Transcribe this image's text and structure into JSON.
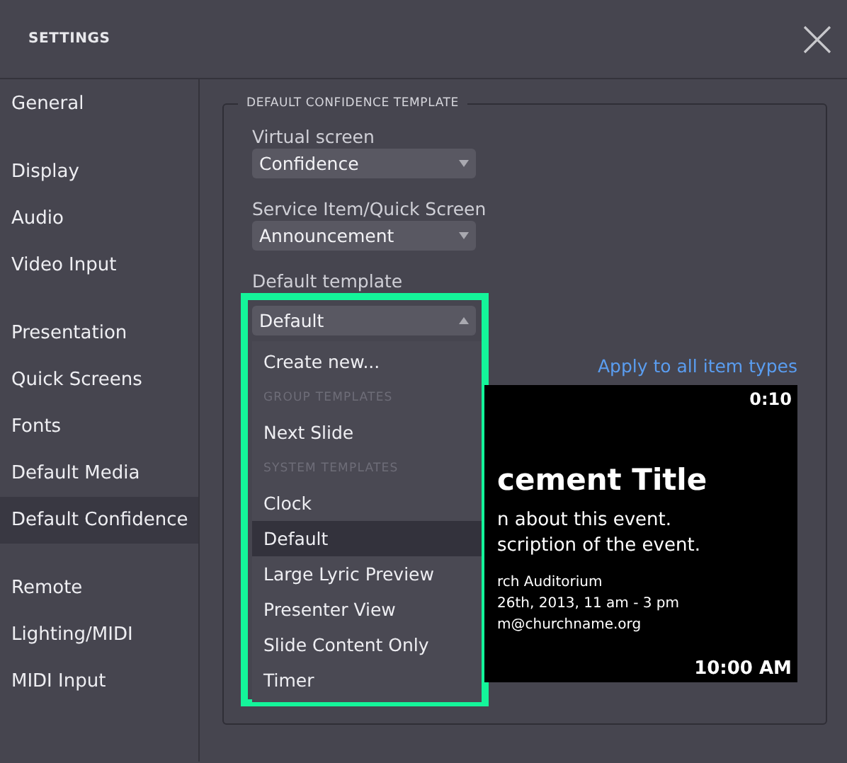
{
  "window": {
    "title": "SETTINGS"
  },
  "sidebar": {
    "groups": [
      {
        "items": [
          {
            "label": "General",
            "selected": false
          }
        ]
      },
      {
        "items": [
          {
            "label": "Display",
            "selected": false
          },
          {
            "label": "Audio",
            "selected": false
          },
          {
            "label": "Video Input",
            "selected": false
          }
        ]
      },
      {
        "items": [
          {
            "label": "Presentation",
            "selected": false
          },
          {
            "label": "Quick Screens",
            "selected": false
          },
          {
            "label": "Fonts",
            "selected": false
          },
          {
            "label": "Default Media",
            "selected": false
          },
          {
            "label": "Default Confidence",
            "selected": true
          }
        ]
      },
      {
        "items": [
          {
            "label": "Remote",
            "selected": false
          },
          {
            "label": "Lighting/MIDI",
            "selected": false
          },
          {
            "label": "MIDI Input",
            "selected": false
          }
        ]
      }
    ]
  },
  "section": {
    "title": "DEFAULT CONFIDENCE TEMPLATE",
    "fields": [
      {
        "label": "Virtual screen",
        "value": "Confidence",
        "expanded": false
      },
      {
        "label": "Service Item/Quick Screen",
        "value": "Announcement",
        "expanded": false
      },
      {
        "label": "Default template",
        "value": "Default",
        "expanded": true
      }
    ],
    "dropdown_menu": [
      {
        "kind": "item",
        "label": "Create new...",
        "selected": false
      },
      {
        "kind": "header",
        "label": "GROUP TEMPLATES"
      },
      {
        "kind": "item",
        "label": "Next Slide",
        "selected": false
      },
      {
        "kind": "header",
        "label": "SYSTEM TEMPLATES"
      },
      {
        "kind": "item",
        "label": "Clock",
        "selected": false
      },
      {
        "kind": "item",
        "label": "Default",
        "selected": true
      },
      {
        "kind": "item",
        "label": "Large Lyric Preview",
        "selected": false
      },
      {
        "kind": "item",
        "label": "Presenter View",
        "selected": false
      },
      {
        "kind": "item",
        "label": "Slide Content Only",
        "selected": false
      },
      {
        "kind": "item",
        "label": "Timer",
        "selected": false
      }
    ],
    "apply_link": "Apply to all item types",
    "preview": {
      "countdown": "0:10",
      "title": "cement Title",
      "lines": [
        "n about this event.",
        "scription of the event."
      ],
      "details": [
        "rch Auditorium",
        "26th, 2013, 11 am - 3 pm",
        "m@churchname.org"
      ],
      "clock": "10:00 AM"
    }
  }
}
